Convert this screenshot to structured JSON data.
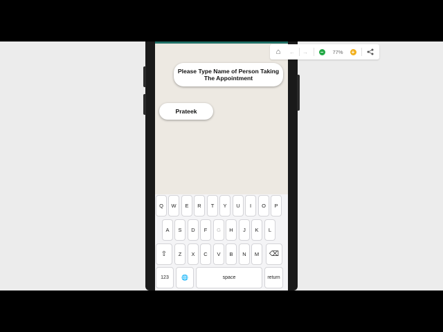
{
  "chat": {
    "prompt_message": "Please Type Name of Person Taking The Appointment",
    "user_reply": "Prateek"
  },
  "keyboard": {
    "row1": [
      "Q",
      "W",
      "E",
      "R",
      "T",
      "Y",
      "U",
      "I",
      "O",
      "P"
    ],
    "row2": [
      "A",
      "S",
      "D",
      "F",
      "G",
      "H",
      "J",
      "K",
      "L"
    ],
    "row3": [
      "Z",
      "X",
      "C",
      "V",
      "B",
      "N",
      "M"
    ],
    "numbers_label": "123",
    "space_label": "space",
    "return_label": "return",
    "shift_glyph": "⇧",
    "backspace_glyph": "⌫",
    "globe_glyph": "🌐"
  },
  "zoom_toolbar": {
    "home_glyph": "⌂",
    "back_glyph": "←",
    "forward_glyph": "→",
    "zoom_out_glyph": "−",
    "zoom_level": "77%",
    "zoom_in_glyph": "+",
    "share_glyph": "⋖",
    "colors": {
      "zoom_out": "#22a845",
      "zoom_in": "#f2b01e",
      "status_strip": "#1f6f66"
    }
  }
}
